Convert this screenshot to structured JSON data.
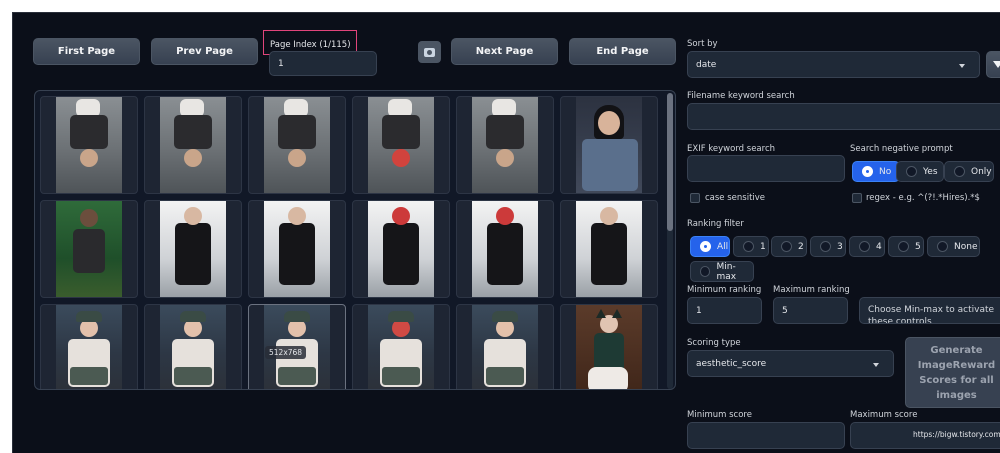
{
  "pagination": {
    "first": "First Page",
    "prev": "Prev Page",
    "next": "Next Page",
    "end": "End Page",
    "page_index_label": "Page Index (1/115)",
    "page_index_value": "1"
  },
  "gallery": {
    "size_tag": "512x768",
    "thumbnails": [
      {
        "theme": "road"
      },
      {
        "theme": "road"
      },
      {
        "theme": "road"
      },
      {
        "theme": "road-red"
      },
      {
        "theme": "road"
      },
      {
        "theme": "street"
      },
      {
        "theme": "forest"
      },
      {
        "theme": "black"
      },
      {
        "theme": "black"
      },
      {
        "theme": "black-red"
      },
      {
        "theme": "black-red"
      },
      {
        "theme": "black"
      },
      {
        "theme": "police"
      },
      {
        "theme": "police"
      },
      {
        "theme": "police",
        "selected": true
      },
      {
        "theme": "police-red"
      },
      {
        "theme": "police"
      },
      {
        "theme": "cat"
      }
    ]
  },
  "sort": {
    "label": "Sort by",
    "value": "date"
  },
  "filename_search": {
    "label": "Filename keyword search",
    "value": ""
  },
  "exif_search": {
    "label": "EXIF keyword search",
    "value": ""
  },
  "negative_prompt": {
    "label": "Search negative prompt",
    "options": [
      "No",
      "Yes",
      "Only"
    ],
    "selected": "No"
  },
  "case_sensitive": "case sensitive",
  "regex": "regex - e.g. ^(?!.*Hires).*$",
  "ranking_filter": {
    "label": "Ranking filter",
    "options": [
      "All",
      "1",
      "2",
      "3",
      "4",
      "5",
      "None",
      "Min-max"
    ],
    "selected": "All"
  },
  "min_ranking": {
    "label": "Minimum ranking",
    "value": "1"
  },
  "max_ranking": {
    "label": "Maximum ranking",
    "value": "5"
  },
  "minmax_hint": "Choose Min-max to activate these controls",
  "scoring": {
    "label": "Scoring type",
    "value": "aesthetic_score"
  },
  "generate_button": "Generate ImageReward Scores for all images",
  "min_score": {
    "label": "Minimum score",
    "value": ""
  },
  "max_score": {
    "label": "Maximum score",
    "value": ""
  },
  "watermark": "https://bigw.tistory.com"
}
